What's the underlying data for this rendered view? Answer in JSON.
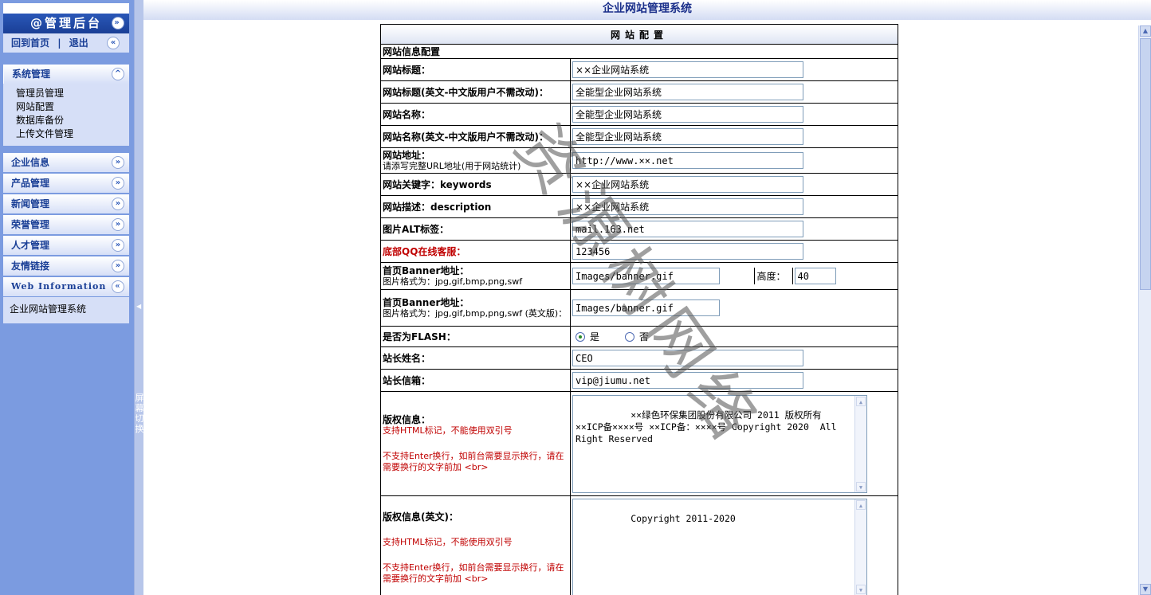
{
  "app": {
    "title": "企业网站管理系统",
    "admin_title": "@管理后台",
    "home_link": "回到首页",
    "separator": "|",
    "logout_link": "退出",
    "watermark": "资源树网络"
  },
  "sidebar": {
    "system_menu": {
      "title": "系统管理",
      "items": [
        "管理员管理",
        "网站配置",
        "数据库备份",
        "上传文件管理"
      ]
    },
    "menus": [
      "企业信息",
      "产品管理",
      "新闻管理",
      "荣誉管理",
      "人才管理",
      "友情链接"
    ],
    "web_info": {
      "title": "Web Information",
      "text": "企业网站管理系统"
    },
    "splitter_text": [
      "屏",
      "幕",
      "切",
      "换"
    ]
  },
  "form": {
    "header": "网站配置",
    "section": "网站信息配置",
    "site_title_label": "网站标题：",
    "site_title_value": "××企业网站系统",
    "site_title_en_label": "网站标题(英文-中文版用户不需改动)：",
    "site_title_en_value": "全能型企业网站系统",
    "site_name_label": "网站名称：",
    "site_name_value": "全能型企业网站系统",
    "site_name_en_label": "网站名称(英文-中文版用户不需改动)：",
    "site_name_en_value": "全能型企业网站系统",
    "site_url_label": "网站地址：",
    "site_url_note": "请添写完整URL地址(用于网站统计)",
    "site_url_value": "http://www.××.net",
    "keywords_label": "网站关键字：keywords",
    "keywords_value": "××企业网站系统",
    "description_label": "网站描述：description",
    "description_value": "××企业网站系统",
    "alt_label": "图片ALT标签：",
    "alt_value": "mail.163.net",
    "qq_label": "底部QQ在线客服：",
    "qq_value": "123456",
    "banner_label": "首页Banner地址：",
    "banner_note": "图片格式为：jpg,gif,bmp,png,swf",
    "banner_value": "Images/banner.gif",
    "height_label": "高度：",
    "height_value": "40",
    "banner_en_label": "首页Banner地址：",
    "banner_en_note": "图片格式为：jpg,gif,bmp,png,swf (英文版)：",
    "banner_en_value": "Images/banner.gif",
    "flash_label": "是否为FLASH：",
    "flash_yes": "是",
    "flash_no": "否",
    "owner_name_label": "站长姓名：",
    "owner_name_value": "CEO",
    "owner_email_label": "站长信箱：",
    "owner_email_value": "vip@jiumu.net",
    "copyright_label": "版权信息：",
    "copyright_note1": "支持HTML标记，不能使用双引号",
    "copyright_note2": "不支持Enter换行，如前台需要显示换行，请在需要换行的文字前加 <br>",
    "copyright_value": "××绿色环保集团股份有限公司 2011 版权所有 ××ICP备××××号 ××ICP备：××××号 Copyright 2020  All Right Reserved",
    "copyright_en_label": "版权信息(英文)：",
    "copyright_en_note1": "支持HTML标记，不能使用双引号",
    "copyright_en_note2": "不支持Enter换行，如前台需要显示换行，请在需要换行的文字前加 <br>",
    "copyright_en_value": "Copyright 2011-2020"
  },
  "colors": {
    "sidebar_bg": "#7b9be0",
    "accent": "#1a3f96",
    "required_red": "#c00000"
  }
}
